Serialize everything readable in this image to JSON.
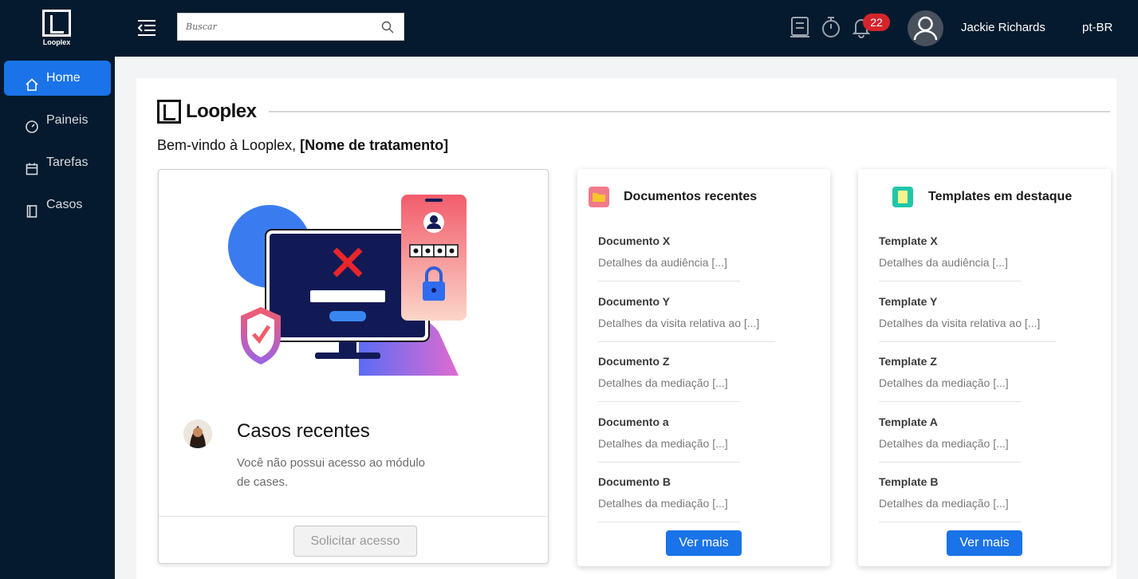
{
  "header": {
    "logo_text": "Looplex",
    "search_placeholder": "Buscar",
    "notification_count": "22",
    "user_name": "Jackie Richards",
    "language": "pt-BR"
  },
  "sidebar": {
    "items": [
      {
        "label": "Home",
        "icon": "home-icon",
        "active": true
      },
      {
        "label": "Paineis",
        "icon": "gauge-icon",
        "active": false
      },
      {
        "label": "Tarefas",
        "icon": "calendar-icon",
        "active": false
      },
      {
        "label": "Casos",
        "icon": "book-icon",
        "active": false
      }
    ]
  },
  "main": {
    "brand": "Looplex",
    "welcome_prefix": "Bem-vindo à Looplex, ",
    "welcome_name": "[Nome de tratamento]",
    "cases": {
      "title": "Casos recentes",
      "message": "Você não possui acesso ao módulo de cases.",
      "request_button": "Solicitar acesso"
    },
    "documents": {
      "title": "Documentos recentes",
      "items": [
        {
          "title": "Documento X",
          "desc": "Detalhes da audiência [...]"
        },
        {
          "title": "Documento Y",
          "desc": "Detalhes da visita relativa ao [...]"
        },
        {
          "title": "Documento Z",
          "desc": "Detalhes da mediação [...]"
        },
        {
          "title": "Documento a",
          "desc": "Detalhes da mediação [...]"
        },
        {
          "title": "Documento B",
          "desc": "Detalhes da mediação [...]"
        }
      ],
      "more_button": "Ver mais"
    },
    "templates": {
      "title": "Templates em destaque",
      "items": [
        {
          "title": "Template X",
          "desc": "Detalhes da audiência [...]"
        },
        {
          "title": "Template Y",
          "desc": "Detalhes da visita relativa ao [...]"
        },
        {
          "title": "Template Z",
          "desc": "Detalhes da mediação [...]"
        },
        {
          "title": "Template A",
          "desc": "Detalhes da mediação [...]"
        },
        {
          "title": "Template B",
          "desc": "Detalhes da mediação [...]"
        }
      ],
      "more_button": "Ver mais"
    }
  },
  "colors": {
    "nav_bg": "#051a2e",
    "accent": "#1a73e8",
    "badge": "#d4252b"
  }
}
